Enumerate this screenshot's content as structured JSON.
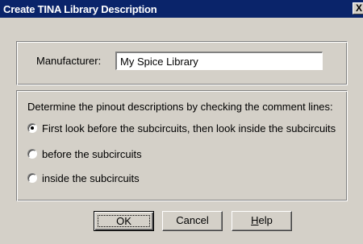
{
  "window": {
    "title": "Create TINA Library Description",
    "close_glyph": "X"
  },
  "manufacturer": {
    "label": "Manufacturer:",
    "value": "My Spice Library"
  },
  "pinout": {
    "instruction": "Determine the pinout descriptions by checking the comment lines:",
    "options": [
      {
        "label": "First look before the subcircuits, then look inside the subcircuits",
        "checked": true
      },
      {
        "label": "before the subcircuits",
        "checked": false
      },
      {
        "label": "inside the subcircuits",
        "checked": false
      }
    ]
  },
  "buttons": {
    "ok": "OK",
    "cancel": "Cancel",
    "help_mnemonic": "H",
    "help_rest": "elp"
  },
  "colors": {
    "titlebar": "#0a246a",
    "face": "#d4d0c8"
  }
}
